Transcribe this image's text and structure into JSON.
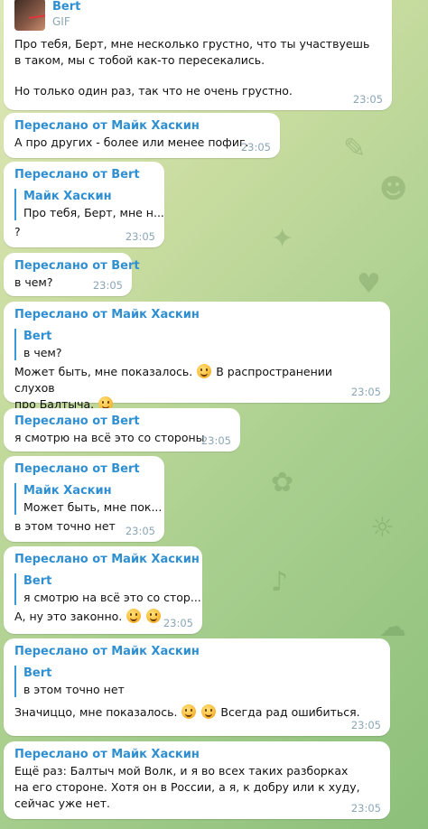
{
  "colors": {
    "forward": "#2f8fd1",
    "time": "#8aa6b5",
    "emoji": "#f7b531"
  },
  "top": {
    "sender": "Bert",
    "media_label": "GIF",
    "text": "Про тебя, Берт, мне несколько грустно, что ты участвуешь в таком, мы с тобой как-то пересекались.",
    "text2": "Но только один раз, так что не очень грустно.",
    "time": "23:05"
  },
  "m1": {
    "fwd": "Переслано от Майк Хаскин",
    "text": "А про других - более или менее пофиг.",
    "time": "23:05"
  },
  "m2": {
    "fwd": "Переслано от Bert",
    "quote_name": "Майк Хаскин",
    "quote_text": "Про тебя, Берт, мне н...",
    "text": "?",
    "time": "23:05"
  },
  "m3": {
    "fwd": "Переслано от Bert",
    "text": "в чем?",
    "time": "23:05"
  },
  "m4": {
    "fwd": "Переслано от Майк Хаскин",
    "quote_name": "Bert",
    "quote_text": "в чем?",
    "text_a": "Может быть, мне показалось.",
    "text_b": "В распространении слухов",
    "text_c": "про Балтыча.",
    "time": "23:05"
  },
  "m5": {
    "fwd": "Переслано от Bert",
    "text": "я смотрю на всё это со стороны",
    "time": "23:05"
  },
  "m6": {
    "fwd": "Переслано от Bert",
    "quote_name": "Майк Хаскин",
    "quote_text": "Может быть, мне пок...",
    "text": "в этом точно нет",
    "time": "23:05"
  },
  "m7": {
    "fwd": "Переслано от Майк Хаскин",
    "quote_name": "Bert",
    "quote_text": "я смотрю на всё это со стор...",
    "text": "А, ну это законно.",
    "time": "23:05"
  },
  "m8": {
    "fwd": "Переслано от Майк Хаскин",
    "quote_name": "Bert",
    "quote_text": "в этом точно нет",
    "text_a": "Значиццо, мне показалось.",
    "text_b": "Всегда рад ошибиться.",
    "time": "23:05"
  },
  "m9": {
    "fwd": "Переслано от Майк Хаскин",
    "text": "Ещё раз: Балтыч мой Волк, и я во всех таких разборках на его стороне. Хотя он в России, а я, к добру или к худу, сейчас уже нет.",
    "time": "23:05"
  }
}
